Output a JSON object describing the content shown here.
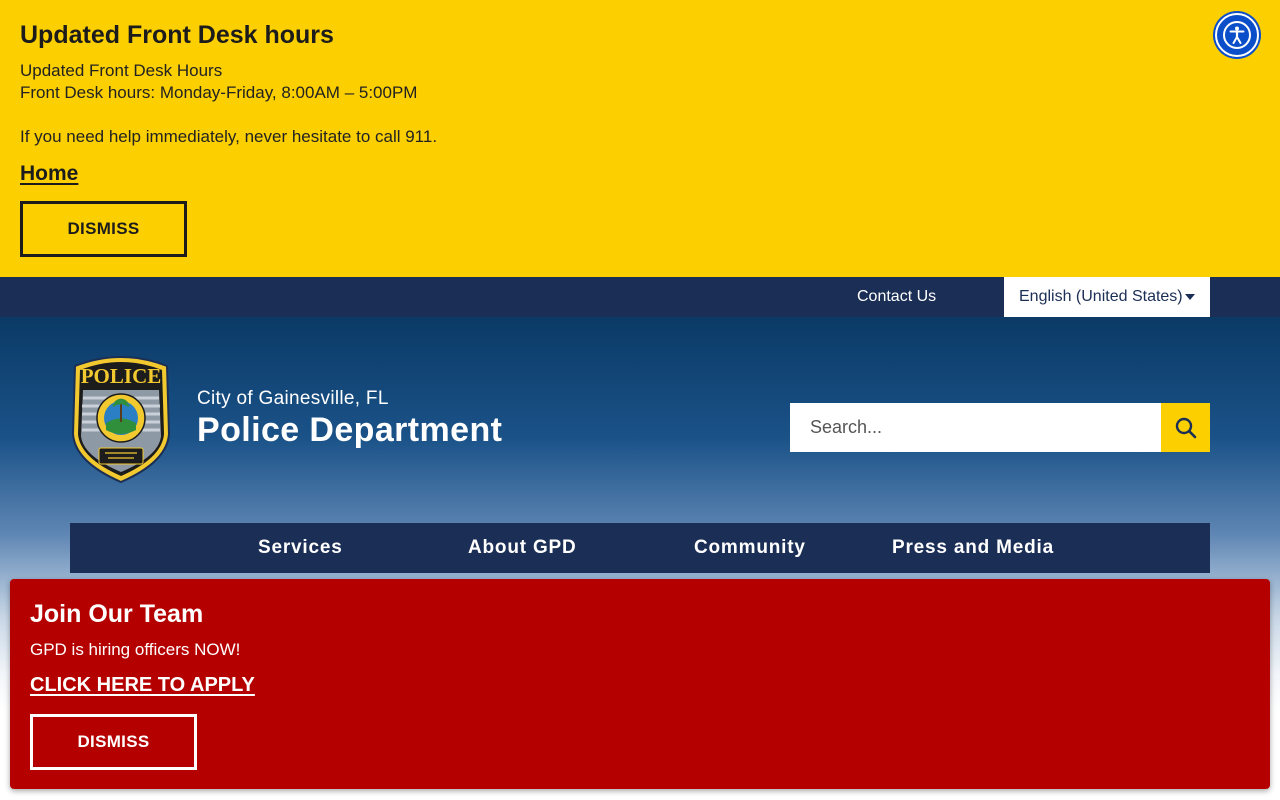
{
  "top_alert": {
    "title": "Updated Front Desk hours",
    "line1": "Updated Front Desk Hours",
    "line2": "Front Desk hours: Monday-Friday, 8:00AM – 5:00PM",
    "line3": "If you need help immediately, never hesitate to call 911.",
    "link_label": "Home",
    "dismiss_label": "DISMISS",
    "background": "#fccf00"
  },
  "accessibility": {
    "icon": "accessibility-icon",
    "color": "#0a4ec9"
  },
  "utility_bar": {
    "contact_label": "Contact Us",
    "language_selected": "English (United States)",
    "background": "#1b2e55"
  },
  "header": {
    "badge_icon": "police-badge-icon",
    "badge_text": "POLICE",
    "subtitle": "City of Gainesville, FL",
    "title": "Police Department"
  },
  "search": {
    "placeholder": "Search...",
    "button_icon": "search-icon",
    "button_color": "#fccf00"
  },
  "nav": {
    "items": [
      {
        "label": "Services"
      },
      {
        "label": "About GPD"
      },
      {
        "label": "Community"
      },
      {
        "label": "Press and Media"
      }
    ]
  },
  "hiring_alert": {
    "title": "Join Our Team",
    "message": "GPD is hiring officers NOW!",
    "link_label": "CLICK HERE TO APPLY",
    "dismiss_label": "DISMISS",
    "background": "#b50000"
  }
}
